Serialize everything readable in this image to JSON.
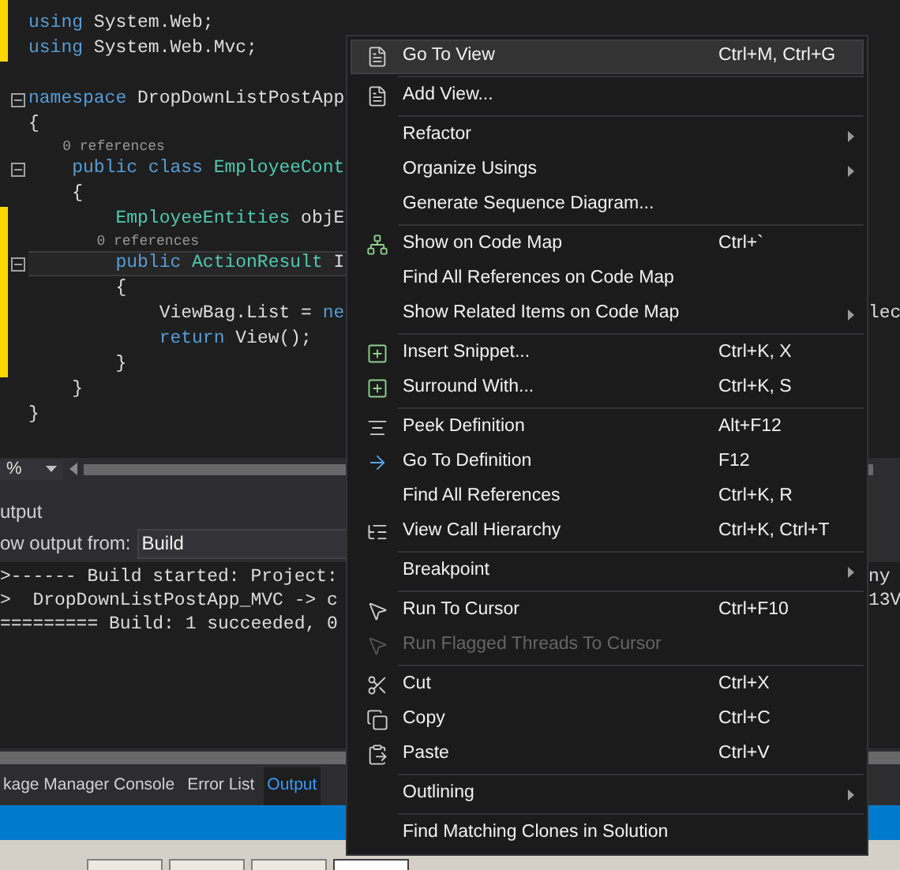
{
  "editor": {
    "lines": [
      {
        "kind": "code",
        "changed": true,
        "fold": false,
        "current": false,
        "tokens": [
          {
            "kind": "keyword",
            "text": "using"
          },
          {
            "kind": "plain",
            "text": " System.Web;"
          }
        ]
      },
      {
        "kind": "code",
        "changed": true,
        "fold": false,
        "current": false,
        "tokens": [
          {
            "kind": "keyword",
            "text": "using"
          },
          {
            "kind": "plain",
            "text": " System.Web.Mvc;"
          }
        ]
      },
      {
        "kind": "code",
        "changed": false,
        "fold": false,
        "current": false
      },
      {
        "kind": "code",
        "changed": false,
        "fold": true,
        "current": false,
        "tokens": [
          {
            "kind": "keyword",
            "text": "namespace"
          },
          {
            "kind": "plain",
            "text": " DropDownListPostApp"
          }
        ]
      },
      {
        "kind": "code",
        "changed": false,
        "fold": false,
        "current": false,
        "tokens": [
          {
            "kind": "plain",
            "text": "{"
          }
        ]
      },
      {
        "kind": "lens",
        "changed": false,
        "fold": false,
        "current": false,
        "tokens": [
          {
            "text": "    0 references"
          }
        ]
      },
      {
        "kind": "code",
        "changed": false,
        "fold": true,
        "current": false,
        "tokens": [
          {
            "kind": "keyword",
            "text": "    public class"
          },
          {
            "kind": "type",
            "text": " EmployeeCont"
          }
        ]
      },
      {
        "kind": "code",
        "changed": false,
        "fold": false,
        "current": false,
        "tokens": [
          {
            "kind": "plain",
            "text": "    {"
          }
        ]
      },
      {
        "kind": "code",
        "changed": true,
        "fold": false,
        "current": false,
        "tokens": [
          {
            "kind": "type",
            "text": "        EmployeeEntities"
          },
          {
            "kind": "plain",
            "text": " objE"
          }
        ]
      },
      {
        "kind": "lens",
        "changed": true,
        "fold": false,
        "current": false,
        "tokens": [
          {
            "text": "        0 references"
          }
        ]
      },
      {
        "kind": "code",
        "changed": true,
        "fold": true,
        "current": true,
        "tokens": [
          {
            "kind": "keyword",
            "text": "        public"
          },
          {
            "kind": "type",
            "text": " ActionResult"
          },
          {
            "kind": "plain",
            "text": " I"
          }
        ]
      },
      {
        "kind": "code",
        "changed": true,
        "fold": false,
        "current": false,
        "tokens": [
          {
            "kind": "plain",
            "text": "        {"
          }
        ]
      },
      {
        "kind": "code",
        "changed": true,
        "fold": false,
        "current": false,
        "tail": "lec",
        "tokens": [
          {
            "kind": "plain",
            "text": "            ViewBag.List = "
          },
          {
            "kind": "keyword",
            "text": "ne"
          }
        ]
      },
      {
        "kind": "code",
        "changed": true,
        "fold": false,
        "current": false,
        "tokens": [
          {
            "kind": "keyword",
            "text": "            return"
          },
          {
            "kind": "plain",
            "text": " View();"
          }
        ]
      },
      {
        "kind": "code",
        "changed": true,
        "fold": false,
        "current": false,
        "tokens": [
          {
            "kind": "plain",
            "text": "        }"
          }
        ]
      },
      {
        "kind": "code",
        "changed": false,
        "fold": false,
        "current": false,
        "tokens": [
          {
            "kind": "plain",
            "text": "    }"
          }
        ]
      },
      {
        "kind": "code",
        "changed": false,
        "fold": false,
        "current": false,
        "tokens": [
          {
            "kind": "plain",
            "text": "}"
          }
        ]
      }
    ],
    "zoom": "%"
  },
  "output": {
    "title": "utput",
    "source_label": "ow output from:",
    "source": "Build",
    "lines": [
      {
        "text": ">------ Build started: Project:",
        "tail": "ny"
      },
      {
        "text": ">  DropDownListPostApp_MVC -> c",
        "tail": "13V"
      },
      {
        "text": "========= Build: 1 succeeded, 0"
      }
    ]
  },
  "bottom_tabs": [
    {
      "label": "kage Manager Console",
      "selected": false
    },
    {
      "label": "Error List",
      "selected": false
    },
    {
      "label": "Output",
      "selected": true
    }
  ],
  "context_menu": [
    {
      "kind": "item",
      "label": "Go To View",
      "shortcut": "Ctrl+M, Ctrl+G",
      "submenu": false,
      "disabled": false,
      "selected": true
    },
    {
      "kind": "separator"
    },
    {
      "kind": "item",
      "label": "Add View...",
      "submenu": false,
      "disabled": false,
      "selected": false
    },
    {
      "kind": "separator"
    },
    {
      "kind": "item",
      "label": "Refactor",
      "submenu": true,
      "disabled": false,
      "selected": false
    },
    {
      "kind": "item",
      "label": "Organize Usings",
      "submenu": true,
      "disabled": false,
      "selected": false
    },
    {
      "kind": "item",
      "label": "Generate Sequence Diagram...",
      "submenu": false,
      "disabled": false,
      "selected": false
    },
    {
      "kind": "separator"
    },
    {
      "kind": "item",
      "label": "Show on Code Map",
      "shortcut": "Ctrl+`",
      "submenu": false,
      "disabled": false,
      "selected": false
    },
    {
      "kind": "item",
      "label": "Find All References on Code Map",
      "submenu": false,
      "disabled": false,
      "selected": false
    },
    {
      "kind": "item",
      "label": "Show Related Items on Code Map",
      "submenu": true,
      "disabled": false,
      "selected": false
    },
    {
      "kind": "separator"
    },
    {
      "kind": "item",
      "label": "Insert Snippet...",
      "shortcut": "Ctrl+K, X",
      "submenu": false,
      "disabled": false,
      "selected": false
    },
    {
      "kind": "item",
      "label": "Surround With...",
      "shortcut": "Ctrl+K, S",
      "submenu": false,
      "disabled": false,
      "selected": false
    },
    {
      "kind": "separator"
    },
    {
      "kind": "item",
      "label": "Peek Definition",
      "shortcut": "Alt+F12",
      "submenu": false,
      "disabled": false,
      "selected": false
    },
    {
      "kind": "item",
      "label": "Go To Definition",
      "shortcut": "F12",
      "submenu": false,
      "disabled": false,
      "selected": false
    },
    {
      "kind": "item",
      "label": "Find All References",
      "shortcut": "Ctrl+K, R",
      "submenu": false,
      "disabled": false,
      "selected": false
    },
    {
      "kind": "item",
      "label": "View Call Hierarchy",
      "shortcut": "Ctrl+K, Ctrl+T",
      "submenu": false,
      "disabled": false,
      "selected": false
    },
    {
      "kind": "separator"
    },
    {
      "kind": "item",
      "label": "Breakpoint",
      "submenu": true,
      "disabled": false,
      "selected": false
    },
    {
      "kind": "separator"
    },
    {
      "kind": "item",
      "label": "Run To Cursor",
      "shortcut": "Ctrl+F10",
      "submenu": false,
      "disabled": false,
      "selected": false
    },
    {
      "kind": "item",
      "label": "Run Flagged Threads To Cursor",
      "submenu": false,
      "disabled": true,
      "selected": false
    },
    {
      "kind": "separator"
    },
    {
      "kind": "item",
      "label": "Cut",
      "shortcut": "Ctrl+X",
      "submenu": false,
      "disabled": false,
      "selected": false
    },
    {
      "kind": "item",
      "label": "Copy",
      "shortcut": "Ctrl+C",
      "submenu": false,
      "disabled": false,
      "selected": false
    },
    {
      "kind": "item",
      "label": "Paste",
      "shortcut": "Ctrl+V",
      "submenu": false,
      "disabled": false,
      "selected": false
    },
    {
      "kind": "separator"
    },
    {
      "kind": "item",
      "label": "Outlining",
      "submenu": true,
      "disabled": false,
      "selected": false
    },
    {
      "kind": "separator"
    },
    {
      "kind": "item",
      "label": "Find Matching Clones in Solution",
      "submenu": false,
      "disabled": false,
      "selected": false
    }
  ]
}
